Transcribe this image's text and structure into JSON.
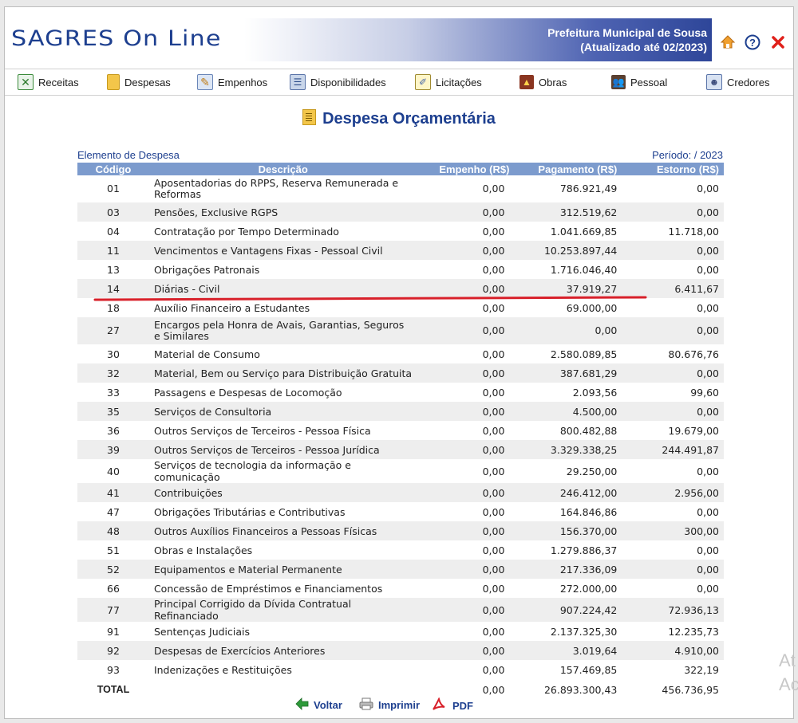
{
  "header": {
    "logo": "SAGRES On Line",
    "org": "Prefeitura Municipal de Sousa",
    "updated": "(Atualizado até 02/2023)"
  },
  "nav": [
    {
      "label": "Receitas",
      "icon": "spreadsheet-icon"
    },
    {
      "label": "Despesas",
      "icon": "document-icon"
    },
    {
      "label": "Empenhos",
      "icon": "pencil-note-icon"
    },
    {
      "label": "Disponibilidades",
      "icon": "ledger-icon"
    },
    {
      "label": "Licitações",
      "icon": "clipboard-icon"
    },
    {
      "label": "Obras",
      "icon": "construction-icon"
    },
    {
      "label": "Pessoal",
      "icon": "people-icon"
    },
    {
      "label": "Credores",
      "icon": "creditor-icon"
    }
  ],
  "page": {
    "title": "Despesa Orçamentária",
    "table_label": "Elemento de Despesa",
    "period": "Período: / 2023"
  },
  "table": {
    "headers": [
      "Código",
      "Descrição",
      "Empenho (R$)",
      "Pagamento (R$)",
      "Estorno (R$)"
    ],
    "rows": [
      {
        "code": "01",
        "desc": "Aposentadorias do RPPS, Reserva Remunerada e Reformas",
        "empenho": "0,00",
        "pagamento": "786.921,49",
        "estorno": "0,00"
      },
      {
        "code": "03",
        "desc": "Pensões, Exclusive RGPS",
        "empenho": "0,00",
        "pagamento": "312.519,62",
        "estorno": "0,00"
      },
      {
        "code": "04",
        "desc": "Contratação por Tempo Determinado",
        "empenho": "0,00",
        "pagamento": "1.041.669,85",
        "estorno": "11.718,00"
      },
      {
        "code": "11",
        "desc": "Vencimentos e Vantagens Fixas - Pessoal Civil",
        "empenho": "0,00",
        "pagamento": "10.253.897,44",
        "estorno": "0,00"
      },
      {
        "code": "13",
        "desc": "Obrigações Patronais",
        "empenho": "0,00",
        "pagamento": "1.716.046,40",
        "estorno": "0,00"
      },
      {
        "code": "14",
        "desc": "Diárias - Civil",
        "empenho": "0,00",
        "pagamento": "37.919,27",
        "estorno": "6.411,67"
      },
      {
        "code": "18",
        "desc": "Auxílio Financeiro a Estudantes",
        "empenho": "0,00",
        "pagamento": "69.000,00",
        "estorno": "0,00"
      },
      {
        "code": "27",
        "desc": "Encargos pela Honra de Avais, Garantias, Seguros e Similares",
        "empenho": "0,00",
        "pagamento": "0,00",
        "estorno": "0,00"
      },
      {
        "code": "30",
        "desc": "Material de Consumo",
        "empenho": "0,00",
        "pagamento": "2.580.089,85",
        "estorno": "80.676,76"
      },
      {
        "code": "32",
        "desc": "Material, Bem ou Serviço para Distribuição Gratuita",
        "empenho": "0,00",
        "pagamento": "387.681,29",
        "estorno": "0,00"
      },
      {
        "code": "33",
        "desc": "Passagens e Despesas de Locomoção",
        "empenho": "0,00",
        "pagamento": "2.093,56",
        "estorno": "99,60"
      },
      {
        "code": "35",
        "desc": "Serviços de Consultoria",
        "empenho": "0,00",
        "pagamento": "4.500,00",
        "estorno": "0,00"
      },
      {
        "code": "36",
        "desc": "Outros Serviços de Terceiros - Pessoa Física",
        "empenho": "0,00",
        "pagamento": "800.482,88",
        "estorno": "19.679,00"
      },
      {
        "code": "39",
        "desc": "Outros Serviços de Terceiros - Pessoa Jurídica",
        "empenho": "0,00",
        "pagamento": "3.329.338,25",
        "estorno": "244.491,87"
      },
      {
        "code": "40",
        "desc": "Serviços de tecnologia da informação e comunicação",
        "empenho": "0,00",
        "pagamento": "29.250,00",
        "estorno": "0,00"
      },
      {
        "code": "41",
        "desc": "Contribuições",
        "empenho": "0,00",
        "pagamento": "246.412,00",
        "estorno": "2.956,00"
      },
      {
        "code": "47",
        "desc": "Obrigações Tributárias e Contributivas",
        "empenho": "0,00",
        "pagamento": "164.846,86",
        "estorno": "0,00"
      },
      {
        "code": "48",
        "desc": "Outros Auxílios Financeiros a Pessoas Físicas",
        "empenho": "0,00",
        "pagamento": "156.370,00",
        "estorno": "300,00"
      },
      {
        "code": "51",
        "desc": "Obras e Instalações",
        "empenho": "0,00",
        "pagamento": "1.279.886,37",
        "estorno": "0,00"
      },
      {
        "code": "52",
        "desc": "Equipamentos e Material Permanente",
        "empenho": "0,00",
        "pagamento": "217.336,09",
        "estorno": "0,00"
      },
      {
        "code": "66",
        "desc": "Concessão de Empréstimos e Financiamentos",
        "empenho": "0,00",
        "pagamento": "272.000,00",
        "estorno": "0,00"
      },
      {
        "code": "77",
        "desc": "Principal Corrigido da Dívida Contratual Refinanciado",
        "empenho": "0,00",
        "pagamento": "907.224,42",
        "estorno": "72.936,13"
      },
      {
        "code": "91",
        "desc": "Sentenças Judiciais",
        "empenho": "0,00",
        "pagamento": "2.137.325,30",
        "estorno": "12.235,73"
      },
      {
        "code": "92",
        "desc": "Despesas de Exercícios Anteriores",
        "empenho": "0,00",
        "pagamento": "3.019,64",
        "estorno": "4.910,00"
      },
      {
        "code": "93",
        "desc": "Indenizações e Restituições",
        "empenho": "0,00",
        "pagamento": "157.469,85",
        "estorno": "322,19"
      }
    ],
    "total": {
      "label": "TOTAL",
      "empenho": "0,00",
      "pagamento": "26.893.300,43",
      "estorno": "456.736,95"
    }
  },
  "footer": {
    "back": "Voltar",
    "print": "Imprimir",
    "pdf": "PDF"
  },
  "side_text": [
    "At",
    "Ac"
  ],
  "colors": {
    "brand": "#1d3f8f",
    "table_header": "#7c9bcd",
    "row_alt": "#eeeeee",
    "highlight_line": "#d8202a"
  }
}
